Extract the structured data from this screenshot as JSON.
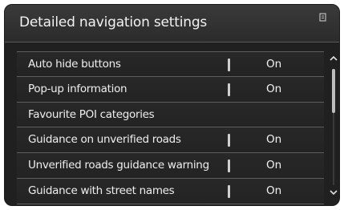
{
  "header": {
    "title": "Detailed navigation settings"
  },
  "settings": {
    "rows": [
      {
        "label": "Auto hide buttons",
        "value": "On"
      },
      {
        "label": "Pop-up information",
        "value": "On"
      },
      {
        "label": "Favourite POI categories",
        "value": ""
      },
      {
        "label": "Guidance on unverified roads",
        "value": "On"
      },
      {
        "label": "Unverified roads guidance warning",
        "value": "On"
      },
      {
        "label": "Guidance with street names",
        "value": "On"
      }
    ]
  },
  "scrollbar": {
    "up_icon": "chevron-up-icon",
    "down_icon": "chevron-down-icon"
  },
  "icons": {
    "corner": "clipboard-icon"
  },
  "colors": {
    "background": "#202020",
    "text": "#eeeeee",
    "divider": "#5e5e5e"
  }
}
